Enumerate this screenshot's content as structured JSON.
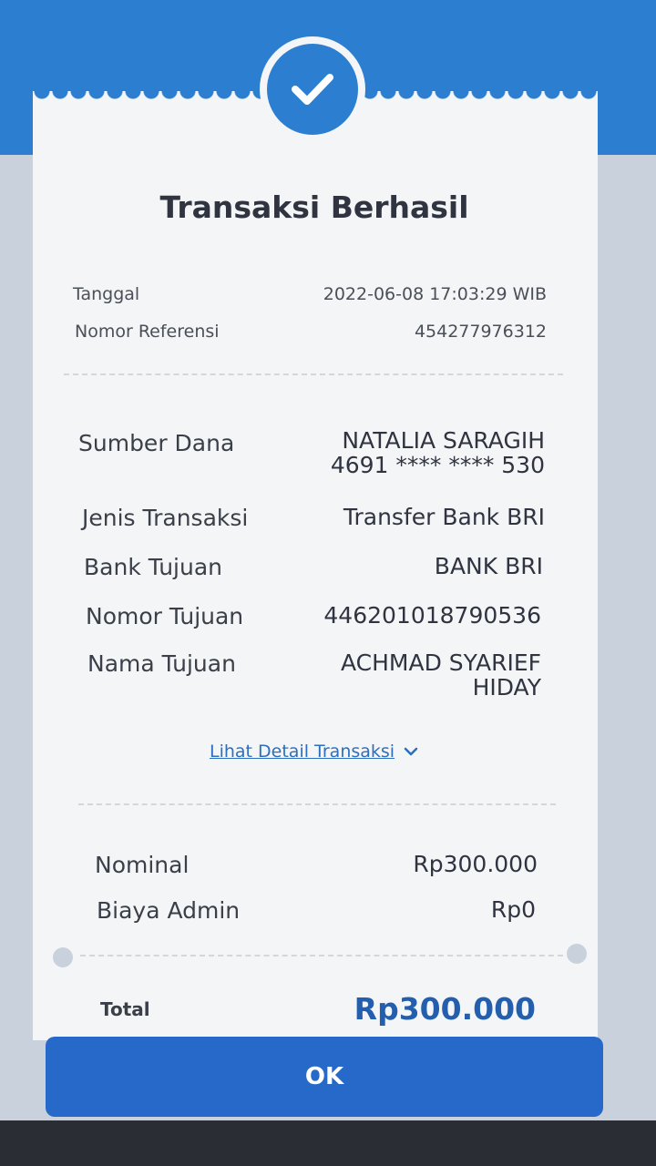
{
  "header": {
    "title": "Transaksi Berhasil",
    "icon": "check-icon",
    "accent_color": "#2c7fd0"
  },
  "meta": {
    "date_label": "Tanggal",
    "date_value": "2022-06-08 17:03:29 WIB",
    "ref_label": "Nomor Referensi",
    "ref_value": "454277976312"
  },
  "details": {
    "source_label": "Sumber Dana",
    "source_name": "NATALIA SARAGIH",
    "source_account": "4691 **** **** 530",
    "type_label": "Jenis Transaksi",
    "type_value": "Transfer Bank BRI",
    "bank_label": "Bank Tujuan",
    "bank_value": "BANK BRI",
    "dest_number_label": "Nomor Tujuan",
    "dest_number_value": "446201018790536",
    "dest_name_label": "Nama Tujuan",
    "dest_name_line1": "ACHMAD SYARIEF",
    "dest_name_line2": "HIDAY"
  },
  "detail_link": {
    "label": "Lihat Detail Transaksi",
    "icon": "chevron-down-icon"
  },
  "amounts": {
    "nominal_label": "Nominal",
    "nominal_value": "Rp300.000",
    "admin_label": "Biaya Admin",
    "admin_value": "Rp0",
    "total_label": "Total",
    "total_value": "Rp300.000"
  },
  "actions": {
    "ok_label": "OK"
  }
}
